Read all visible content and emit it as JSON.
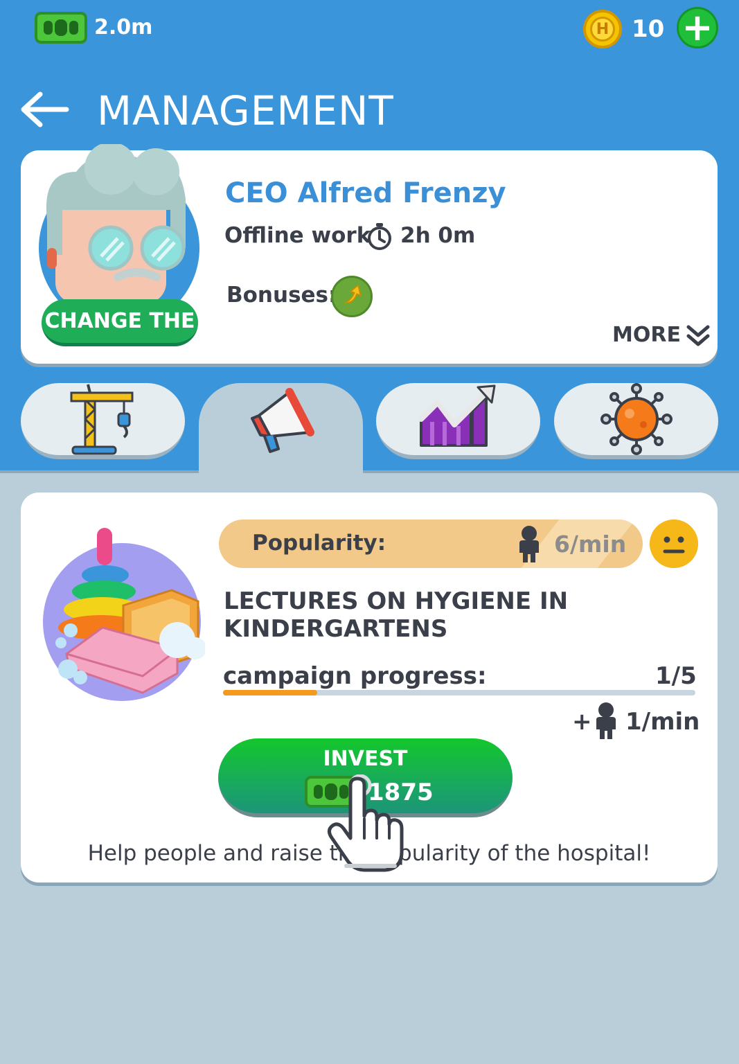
{
  "status_bar": {
    "cash": "2.0m",
    "coins": "10",
    "add_label": "+",
    "coin_letter": "H"
  },
  "header": {
    "title": "MANAGEMENT"
  },
  "ceo": {
    "name": "CEO Alfred Frenzy",
    "offline_label": "Offline work",
    "offline_time": "2h 0m",
    "bonuses_label": "Bonuses:",
    "change_button": "CHANGE THE",
    "more_label": "MORE"
  },
  "tabs": [
    {
      "name": "construction",
      "icon": "crane-icon",
      "active": false
    },
    {
      "name": "marketing",
      "icon": "megaphone-icon",
      "active": true
    },
    {
      "name": "statistics",
      "icon": "chart-growth-icon",
      "active": false
    },
    {
      "name": "virus",
      "icon": "virus-icon",
      "active": false
    }
  ],
  "campaign": {
    "popularity_label": "Popularity:",
    "popularity_rate": "6/min",
    "title": "LECTURES ON HYGIENE IN KINDERGARTENS",
    "progress_label": "campaign progress:",
    "progress_value": "1/5",
    "progress_fraction": 0.2,
    "gain_plus": "+",
    "gain_rate": "1/min",
    "invest_label": "INVEST",
    "invest_cost": "1875",
    "description": "Help people and raise the popularity of the hospital!"
  },
  "colors": {
    "top_background": "#3a95da",
    "body_background": "#b9ced8",
    "accent_blue": "#3b8fd6",
    "button_green": "#1fae57",
    "progress_orange": "#f39a1e",
    "popularity_bar": "#f3c98a"
  }
}
